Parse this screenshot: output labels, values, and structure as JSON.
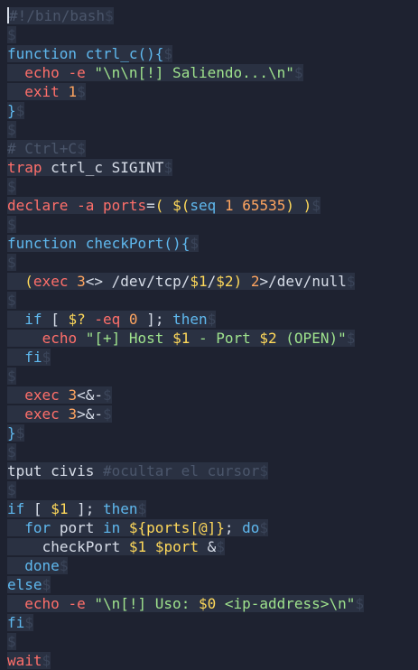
{
  "editor": {
    "eol_marker": "$",
    "lines": [
      {
        "text": "#!/bin/bash"
      },
      {
        "text": ""
      },
      {
        "text": "function ctrl_c(){"
      },
      {
        "text": "  echo -e \"\\n\\n[!] Saliendo...\\n\""
      },
      {
        "text": "  exit 1"
      },
      {
        "text": "}"
      },
      {
        "text": ""
      },
      {
        "text": "# Ctrl+C"
      },
      {
        "text": "trap ctrl_c SIGINT"
      },
      {
        "text": ""
      },
      {
        "text": "declare -a ports=( $(seq 1 65535) )"
      },
      {
        "text": ""
      },
      {
        "text": "function checkPort(){"
      },
      {
        "text": ""
      },
      {
        "text": "  (exec 3<> /dev/tcp/$1/$2) 2>/dev/null"
      },
      {
        "text": ""
      },
      {
        "text": "  if [ $? -eq 0 ]; then"
      },
      {
        "text": "    echo \"[+] Host $1 - Port $2 (OPEN)\""
      },
      {
        "text": "  fi"
      },
      {
        "text": ""
      },
      {
        "text": "  exec 3<&-"
      },
      {
        "text": "  exec 3>&-"
      },
      {
        "text": "}"
      },
      {
        "text": ""
      },
      {
        "text": "tput civis #ocultar el cursor"
      },
      {
        "text": ""
      },
      {
        "text": "if [ $1 ]; then"
      },
      {
        "text": "  for port in ${ports[@]}; do"
      },
      {
        "text": "    checkPort $1 $port &"
      },
      {
        "text": "  done"
      },
      {
        "text": "else"
      },
      {
        "text": "  echo -e \"\\n[!] Uso: $0 <ip-address>\\n\""
      },
      {
        "text": "fi"
      },
      {
        "text": ""
      },
      {
        "text": "wait"
      }
    ]
  },
  "colors": {
    "background": "#1e2230",
    "line_highlight": "#2a3142",
    "comment": "#4b566b",
    "keyword": "#5fb8ee",
    "command": "#ff6f6a",
    "string": "#9fe38d",
    "number": "#ffa560",
    "variable": "#ffd95a",
    "text": "#d7dde8"
  }
}
